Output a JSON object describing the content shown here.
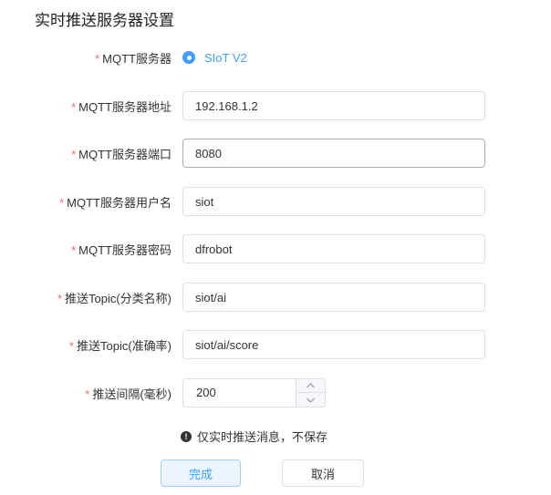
{
  "page": {
    "title": "实时推送服务器设置"
  },
  "form": {
    "required_mark": "*",
    "server": {
      "label": "MQTT服务器",
      "option": "SIoT V2",
      "selected": true
    },
    "address": {
      "label": "MQTT服务器地址",
      "value": "192.168.1.2"
    },
    "port": {
      "label": "MQTT服务器端口",
      "value": "8080"
    },
    "username": {
      "label": "MQTT服务器用户名",
      "value": "siot"
    },
    "password": {
      "label": "MQTT服务器密码",
      "value": "dfrobot"
    },
    "topic_class": {
      "label": "推送Topic(分类名称)",
      "value": "siot/ai"
    },
    "topic_score": {
      "label": "推送Topic(准确率)",
      "value": "siot/ai/score"
    },
    "interval": {
      "label": "推送间隔(毫秒)",
      "value": "200",
      "up_icon": "chevron-up-icon",
      "down_icon": "chevron-down-icon"
    }
  },
  "note": {
    "icon": "info-icon",
    "text": "仅实时推送消息，不保存"
  },
  "buttons": {
    "confirm": "完成",
    "cancel": "取消"
  },
  "colors": {
    "accent": "#409eff",
    "required": "#f56c6c",
    "border": "#dcdfe6"
  }
}
